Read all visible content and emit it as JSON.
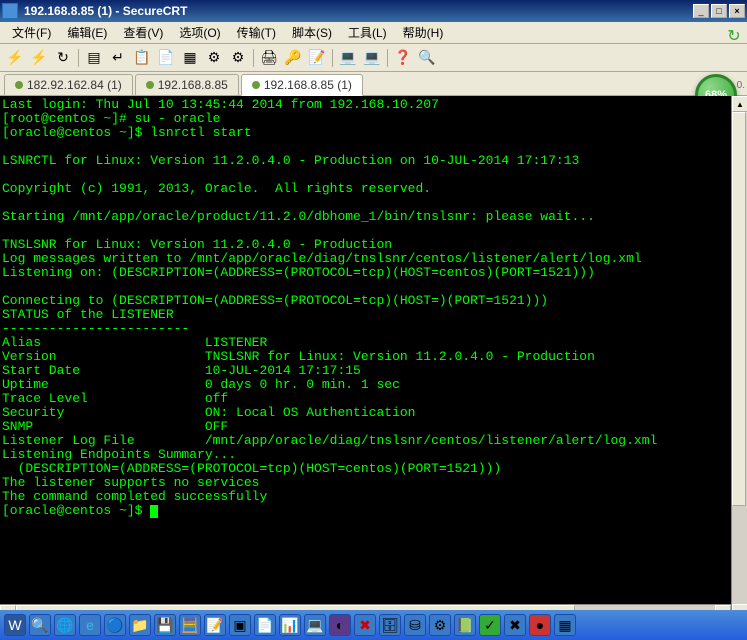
{
  "window": {
    "title": "192.168.8.85 (1) - SecureCRT",
    "min": "_",
    "max": "□",
    "close": "×"
  },
  "menu": {
    "file": "文件(F)",
    "edit": "编辑(E)",
    "view": "查看(V)",
    "options": "选项(O)",
    "transfer": "传输(T)",
    "script": "脚本(S)",
    "tools": "工具(L)",
    "help": "帮助(H)"
  },
  "toolbar_icons": {
    "connect": "connect-icon",
    "quick": "quick-connect-icon",
    "reconnect": "reconnect-icon",
    "disconnect": "disconnect-icon",
    "copy": "copy-icon",
    "paste": "paste-icon",
    "find": "find-icon",
    "props": "props-icon",
    "key": "key-icon",
    "print": "print-icon",
    "help": "help-icon",
    "font1": "font1-icon",
    "font2": "font2-icon"
  },
  "tabs": [
    {
      "label": "182.92.162.84 (1)",
      "active": false
    },
    {
      "label": "192.168.8.85",
      "active": false
    },
    {
      "label": "192.168.8.85 (1)",
      "active": true
    }
  ],
  "badge": "68%",
  "side": {
    "top": "0.",
    "bot": "↓"
  },
  "terminal": {
    "lines": "Last login: Thu Jul 10 13:45:44 2014 from 192.168.10.207\n[root@centos ~]# su - oracle\n[oracle@centos ~]$ lsnrctl start\n\nLSNRCTL for Linux: Version 11.2.0.4.0 - Production on 10-JUL-2014 17:17:13\n\nCopyright (c) 1991, 2013, Oracle.  All rights reserved.\n\nStarting /mnt/app/oracle/product/11.2.0/dbhome_1/bin/tnslsnr: please wait...\n\nTNSLSNR for Linux: Version 11.2.0.4.0 - Production\nLog messages written to /mnt/app/oracle/diag/tnslsnr/centos/listener/alert/log.xml\nListening on: (DESCRIPTION=(ADDRESS=(PROTOCOL=tcp)(HOST=centos)(PORT=1521)))\n\nConnecting to (DESCRIPTION=(ADDRESS=(PROTOCOL=tcp)(HOST=)(PORT=1521)))\nSTATUS of the LISTENER\n------------------------\nAlias                     LISTENER\nVersion                   TNSLSNR for Linux: Version 11.2.0.4.0 - Production\nStart Date                10-JUL-2014 17:17:15\nUptime                    0 days 0 hr. 0 min. 1 sec\nTrace Level               off\nSecurity                  ON: Local OS Authentication\nSNMP                      OFF\nListener Log File         /mnt/app/oracle/diag/tnslsnr/centos/listener/alert/log.xml\nListening Endpoints Summary...\n  (DESCRIPTION=(ADDRESS=(PROTOCOL=tcp)(HOST=centos)(PORT=1521)))\nThe listener supports no services\nThe command completed successfully\n[oracle@centos ~]$ "
  },
  "taskbar": [
    "word-icon",
    "magnify-icon",
    "browser-icon",
    "ie-icon",
    "chrome-icon",
    "folder-icon",
    "disk-icon",
    "calc-icon",
    "note-icon",
    "term-icon",
    "app1-icon",
    "app2-icon",
    "crt-icon",
    "eclipse-icon",
    "x-icon",
    "db-icon",
    "sql-icon",
    "gear-icon",
    "dict-icon",
    "green-icon",
    "x2-icon",
    "red-icon"
  ]
}
